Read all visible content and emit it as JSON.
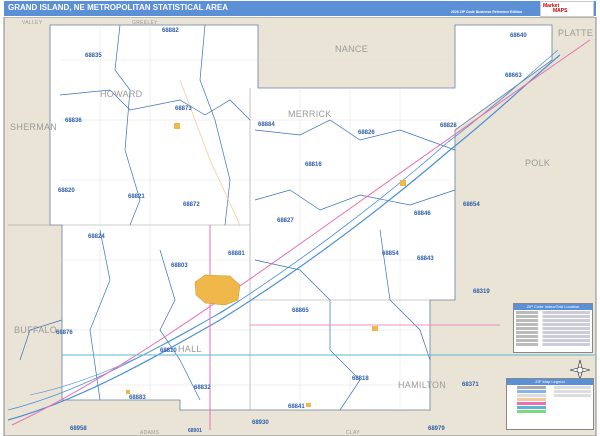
{
  "header": {
    "title": "GRAND ISLAND, NE METROPOLITAN STATISTICAL AREA",
    "edition": "2026 ZIP Code Business Reference Edition",
    "logo_text": "Market MAPS"
  },
  "counties": {
    "valley": "VALLEY",
    "greeley": "GREELEY",
    "nance": "NANCE",
    "platte": "PLATTE",
    "howard": "HOWARD",
    "merrick": "MERRICK",
    "sherman": "SHERMAN",
    "polk": "POLK",
    "buffalo": "BUFFALO",
    "hall": "HALL",
    "hamilton": "HAMILTON",
    "adams": "ADAMS",
    "clay": "CLAY"
  },
  "zips": [
    "68882",
    "68835",
    "68873",
    "68836",
    "68884",
    "68826",
    "68828",
    "68640",
    "68663",
    "68816",
    "68820",
    "68821",
    "68872",
    "68827",
    "68846",
    "68654",
    "68824",
    "68803",
    "68881",
    "68854",
    "68843",
    "68319",
    "68876",
    "68865",
    "68810",
    "68832",
    "68818",
    "68371",
    "68883",
    "68841",
    "68930",
    "68958",
    "68901",
    "68979"
  ],
  "legends": {
    "index_title": "ZIP Code Index/Grid Location",
    "map_legend_title": "ZIP Map Legend"
  },
  "colors": {
    "water": "#4a8fd4",
    "highway": "#e86fb0",
    "boundary": "#3a6fc0",
    "outside": "#e9e4d6",
    "title_bar": "#5b8fd6"
  }
}
